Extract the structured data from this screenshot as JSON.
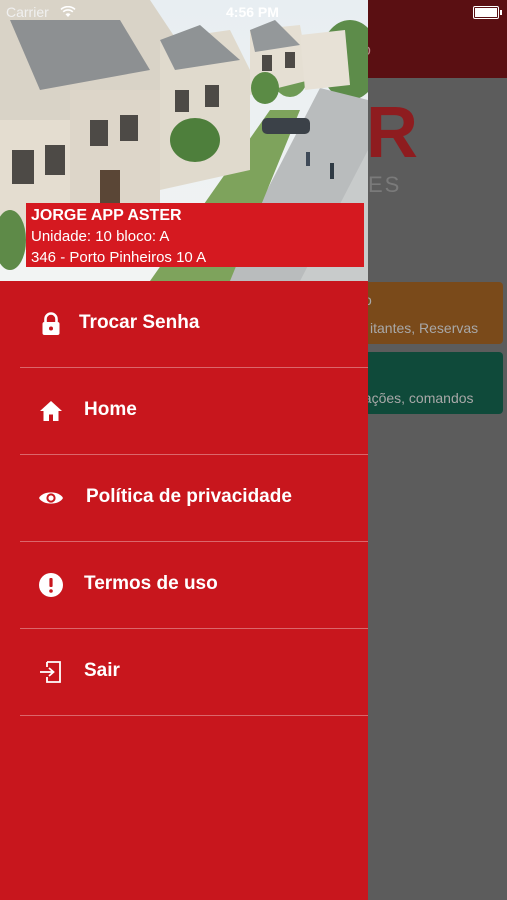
{
  "status_bar": {
    "carrier": "Carrier",
    "time": "4:56 PM",
    "battery_level": 1.0
  },
  "background_app": {
    "header_title": "o",
    "logo": "R",
    "logo_sub": "ES",
    "cards": [
      {
        "title": "o",
        "subtitle": "itantes, Reservas"
      },
      {
        "title": "",
        "subtitle": "nações, comandos"
      }
    ]
  },
  "drawer": {
    "user": {
      "name": "JORGE APP ASTER",
      "unit": "Unidade: 10 bloco: A",
      "address": "346 - Porto Pinheiros 10 A"
    },
    "menu": [
      {
        "label": "Trocar Senha",
        "icon": "lock-icon"
      },
      {
        "label": "Home",
        "icon": "home-icon"
      },
      {
        "label": "Política de privacidade",
        "icon": "eye-icon"
      },
      {
        "label": "Termos de uso",
        "icon": "alert-icon"
      },
      {
        "label": "Sair",
        "icon": "logout-icon"
      }
    ]
  },
  "colors": {
    "drawer": "#c8161d",
    "user_box": "#d51920",
    "overlay": "#5c5c5c"
  }
}
